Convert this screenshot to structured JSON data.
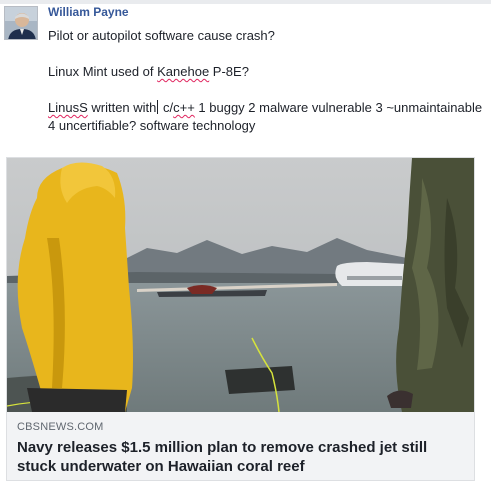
{
  "post": {
    "author": "William Payne",
    "lines": {
      "l1": "Pilot or autopilot software cause crash?",
      "l2_a": "Linux Mint used of ",
      "l2_b": "Kanehoe",
      "l2_c": " P-8E?",
      "l3_a": "LinusS",
      "l3_b": " written with",
      "l3_c": " c/",
      "l3_d": "c++",
      "l3_e": " 1 buggy 2 malware vulnerable 3 ~unmaintainable 4 uncertifiable? software technology"
    }
  },
  "link_card": {
    "domain": "CBSNEWS.COM",
    "title": "Navy releases $1.5 million plan to remove crashed jet still stuck underwater on Hawaiian coral reef"
  },
  "icons": {
    "avatar": "profile-photo",
    "image": "news-photo-crashed-jet-in-bay"
  }
}
